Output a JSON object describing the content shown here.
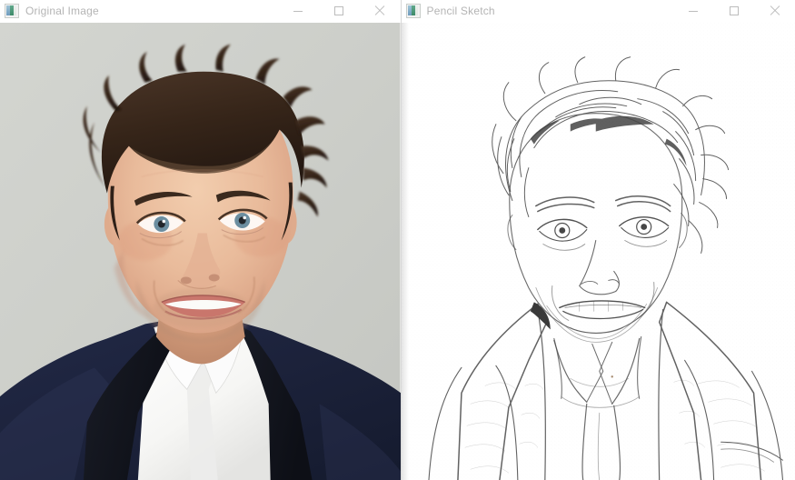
{
  "desktop": {
    "background_color": "#ffffff"
  },
  "windows": [
    {
      "id": "original-image",
      "title": "Original Image",
      "icon": "image-window-icon",
      "title_color": "#b4b4b4",
      "titlebar_color": "#ffffff",
      "content": {
        "kind": "photograph",
        "subject": "portrait of a man in a dark navy suit with black shawl lapels and open white dress shirt",
        "background_color": "#cdcfca",
        "skin_color": "#e8b99a",
        "hair_color": "#3a2a20",
        "suit_color": "#1b2139",
        "lapel_color": "#14161f",
        "shirt_color": "#fbfbfb"
      },
      "buttons": [
        {
          "name": "minimize",
          "glyph": "minimize-icon"
        },
        {
          "name": "maximize",
          "glyph": "maximize-icon"
        },
        {
          "name": "close",
          "glyph": "close-icon"
        }
      ]
    },
    {
      "id": "pencil-sketch",
      "title": "Pencil Sketch",
      "icon": "image-window-icon",
      "title_color": "#b4b4b4",
      "titlebar_color": "#ffffff",
      "content": {
        "kind": "pencil-sketch",
        "subject": "pencil sketch rendering of the same portrait, white background with fine graphite line work",
        "background_color": "#ffffff",
        "line_color": "#3a3a3a",
        "shade_color": "#9a9a9a"
      },
      "buttons": [
        {
          "name": "minimize",
          "glyph": "minimize-icon"
        },
        {
          "name": "maximize",
          "glyph": "maximize-icon"
        },
        {
          "name": "close",
          "glyph": "close-icon"
        }
      ]
    }
  ]
}
